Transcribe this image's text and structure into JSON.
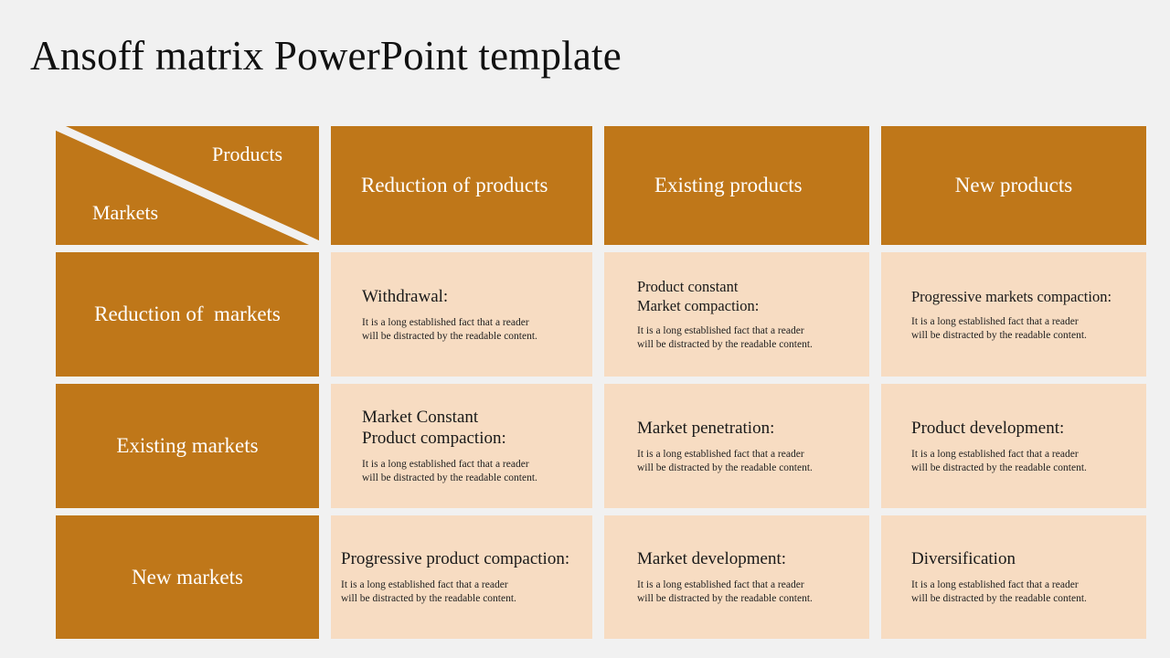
{
  "title": "Ansoff matrix PowerPoint template",
  "colors": {
    "background": "#f1f1f1",
    "accent_orange": "#bf7719",
    "cell_peach": "#f7dcc2",
    "header_text": "#ffffff",
    "body_text": "#1a1a1a"
  },
  "corner": {
    "products_label": "Products",
    "markets_label": "Markets",
    "divider": "diagonal-line"
  },
  "column_headers": [
    "Reduction of products",
    "Existing products",
    "New products"
  ],
  "row_headers": [
    "Reduction of  markets",
    "Existing markets",
    "New markets"
  ],
  "body_text": "It is  a long established fact that a reader\nwill  be distracted by the readable content.",
  "cells": [
    {
      "row": "Reduction of  markets",
      "column": "Reduction of products",
      "heading": "Withdrawal:",
      "body": "It is  a long established fact that a reader\nwill  be distracted by the readable content."
    },
    {
      "row": "Reduction of  markets",
      "column": "Existing products",
      "heading": "Product constant\n Market compaction:",
      "body": "It is  a long established fact that a reader\nwill  be distracted by the readable content."
    },
    {
      "row": "Reduction of  markets",
      "column": "New products",
      "heading": "Progressive markets compaction:",
      "body": "It is  a long established fact that a reader\nwill  be distracted by the readable content."
    },
    {
      "row": "Existing markets",
      "column": "Reduction of products",
      "heading": "Market Constant\nProduct compaction:",
      "body": "It is  a long established fact that a reader\nwill  be distracted by the readable content."
    },
    {
      "row": "Existing markets",
      "column": "Existing products",
      "heading": "Market penetration:",
      "body": "It is  a long established fact that a reader\nwill  be distracted by the readable content."
    },
    {
      "row": "Existing markets",
      "column": "New products",
      "heading": "Product development:",
      "body": "It is  a long established fact that a reader\nwill  be distracted by the readable content."
    },
    {
      "row": "New markets",
      "column": "Reduction of products",
      "heading": "Progressive product compaction:",
      "body": "It is  a long established fact that a reader\nwill  be distracted by the readable content."
    },
    {
      "row": "New markets",
      "column": "Existing products",
      "heading": "Market development:",
      "body": "It is  a long established fact that a reader\nwill  be distracted by the readable content."
    },
    {
      "row": "New markets",
      "column": "New products",
      "heading": "Diversification",
      "body": "It is  a long established fact that a reader\nwill  be distracted by the readable content."
    }
  ]
}
